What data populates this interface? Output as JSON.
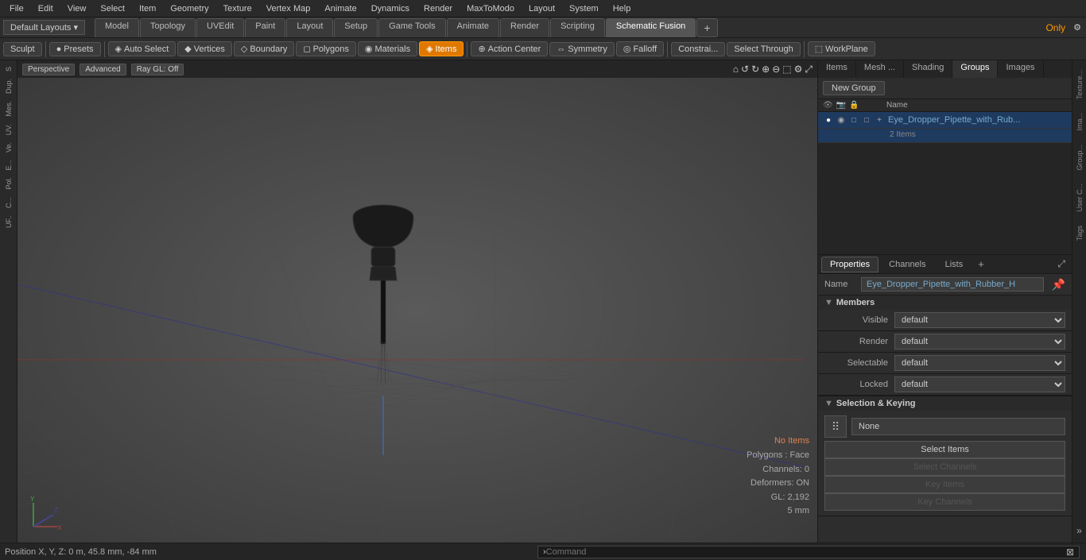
{
  "menubar": {
    "items": [
      "File",
      "Edit",
      "View",
      "Select",
      "Item",
      "Geometry",
      "Texture",
      "Vertex Map",
      "Animate",
      "Dynamics",
      "Render",
      "MaxToModo",
      "Layout",
      "System",
      "Help"
    ]
  },
  "layout": {
    "dropdown": "Default Layouts ▾",
    "tabs": [
      "Model",
      "Topology",
      "UVEdit",
      "Paint",
      "Layout",
      "Setup",
      "Game Tools",
      "Animate",
      "Render",
      "Scripting",
      "Schematic Fusion"
    ],
    "active_tab": "Schematic Fusion",
    "add_icon": "+",
    "right": {
      "star": "★",
      "star_label": "Only",
      "gear": "⚙"
    }
  },
  "toolbar": {
    "sculpt": "Sculpt",
    "presets": "Presets",
    "autoselect": "Auto Select",
    "vertices": "Vertices",
    "boundary": "Boundary",
    "polygons": "Polygons",
    "materials": "Materials",
    "items": "Items",
    "action_center": "Action Center",
    "symmetry": "Symmetry",
    "falloff": "Falloff",
    "constraints": "Constrai...",
    "select_through": "Select Through",
    "workplane": "WorkPlane"
  },
  "viewport": {
    "mode": "Perspective",
    "level": "Advanced",
    "render": "Ray GL: Off",
    "info": {
      "no_items": "No Items",
      "polygons": "Polygons : Face",
      "channels": "Channels: 0",
      "deformers": "Deformers: ON",
      "gl": "GL: 2,192",
      "mm": "5 mm"
    }
  },
  "left_sidebar": {
    "icons": [
      "S",
      "Dup.",
      "Mes.",
      "UV.",
      "Ve.",
      "E...",
      "Pol.",
      "C...",
      "UF.."
    ]
  },
  "groups": {
    "tabs": [
      "Items",
      "Mesh ...",
      "Shading",
      "Groups",
      "Images"
    ],
    "active_tab": "Groups",
    "new_group_btn": "New Group",
    "col_name": "Name",
    "group_item": {
      "name": "Eye_Dropper_Pipette_with_Rub...",
      "count": "2 Items"
    }
  },
  "props": {
    "tabs": [
      "Properties",
      "Channels",
      "Lists"
    ],
    "active_tab": "Properties",
    "name_label": "Name",
    "name_value": "Eye_Dropper_Pipette_with_Rubber_H",
    "sections": {
      "members": {
        "title": "Members",
        "rows": [
          {
            "label": "Visible",
            "value": "default"
          },
          {
            "label": "Render",
            "value": "default"
          },
          {
            "label": "Selectable",
            "value": "default"
          },
          {
            "label": "Locked",
            "value": "default"
          }
        ]
      },
      "selection_keying": {
        "title": "Selection & Keying",
        "icon_dots": "⠿",
        "none_label": "None",
        "buttons": [
          {
            "label": "Select Items",
            "enabled": true
          },
          {
            "label": "Select Channels",
            "enabled": false
          },
          {
            "label": "Key Items",
            "enabled": false
          },
          {
            "label": "Key Channels",
            "enabled": false
          }
        ]
      }
    }
  },
  "right_edge": {
    "tabs": [
      "Texture...",
      "Ima...",
      "Group...",
      "User C...",
      "Tags"
    ]
  },
  "bottom": {
    "position": "Position X, Y, Z:  0 m, 45.8 mm, -84 mm",
    "command_placeholder": "Command",
    "arrow": "›"
  },
  "colors": {
    "accent_orange": "#e07800",
    "accent_blue": "#7ac",
    "active_blue_bg": "#1f3a5f",
    "panel_bg": "#2d2d2d",
    "dark_bg": "#252525"
  }
}
